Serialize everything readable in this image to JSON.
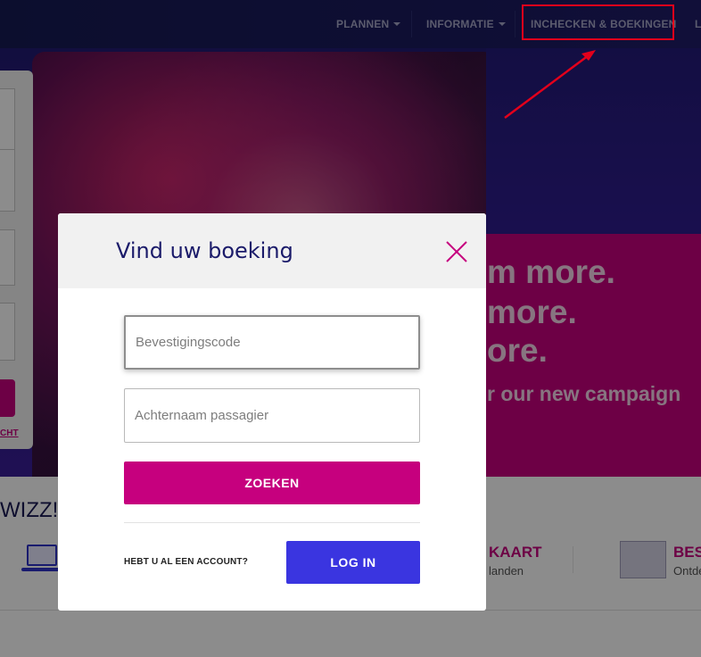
{
  "header": {
    "nav": [
      {
        "label": "PLANNEN",
        "has_dropdown": true
      },
      {
        "label": "INFORMATIE",
        "has_dropdown": true
      },
      {
        "label": "INCHECKEN & BOEKINGEN",
        "has_dropdown": false,
        "highlighted": true
      },
      {
        "label": "L",
        "has_dropdown": false
      }
    ]
  },
  "hero": {
    "banner_lines": [
      "m more.",
      "more.",
      "ore.",
      "r our new campaign"
    ]
  },
  "left_panel": {
    "link_text": "CHT"
  },
  "below": {
    "title": "WIZZ!",
    "features": [
      {
        "title": "KAART",
        "subtitle": "landen"
      },
      {
        "title": "BES",
        "subtitle": "Ontde"
      }
    ]
  },
  "modal": {
    "title": "Vind uw boeking",
    "close_icon": "close-icon",
    "confirmation_field": {
      "placeholder": "Bevestigingscode",
      "value": ""
    },
    "lastname_field": {
      "placeholder": "Achternaam passagier",
      "value": ""
    },
    "search_label": "ZOEKEN",
    "account_question": "HEBT U AL EEN ACCOUNT?",
    "login_label": "LOG IN"
  },
  "colors": {
    "brand_magenta": "#c6007e",
    "login_blue": "#3a35e0",
    "header_navy": "#1a1b5e",
    "annotation_red": "#e3001b"
  }
}
